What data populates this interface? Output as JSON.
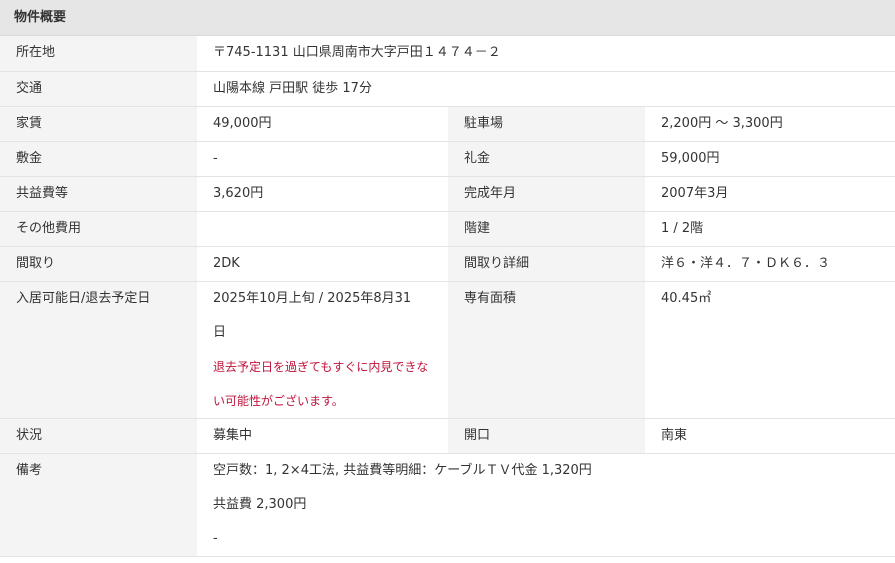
{
  "section_title": "物件概要",
  "rows": {
    "address": {
      "label": "所在地",
      "value": "〒745-1131 山口県周南市大字戸田１４７４－２"
    },
    "access": {
      "label": "交通",
      "value": "山陽本線 戸田駅 徒歩 17分"
    },
    "rent": {
      "label": "家賃",
      "value": "49,000円"
    },
    "parking": {
      "label": "駐車場",
      "value": "2,200円 ～ 3,300円"
    },
    "deposit": {
      "label": "敷金",
      "value": "-"
    },
    "key_money": {
      "label": "礼金",
      "value": "59,000円"
    },
    "common_fee": {
      "label": "共益費等",
      "value": "3,620円"
    },
    "built": {
      "label": "完成年月",
      "value": "2007年3月"
    },
    "other_costs": {
      "label": "その他費用",
      "value": ""
    },
    "floor": {
      "label": "階建",
      "value": "1 / 2階"
    },
    "layout": {
      "label": "間取り",
      "value": "2DK"
    },
    "layout_detail": {
      "label": "間取り詳細",
      "value": "洋６・洋４．７・ＤＫ６．３"
    },
    "move_in": {
      "label": "入居可能日/退去予定日",
      "value_line1": "2025年10月上旬 / 2025年8月31",
      "value_line2": "日",
      "note_line1": "退去予定日を過ぎてもすぐに内見できな",
      "note_line2": "い可能性がございます。"
    },
    "area": {
      "label": "専有面積",
      "value": "40.45㎡"
    },
    "status": {
      "label": "状況",
      "value": "募集中"
    },
    "facing": {
      "label": "開口",
      "value": "南東"
    },
    "remarks": {
      "label": "備考",
      "line1": "空戸数：1, 2×4工法, 共益費等明細：ケーブルＴＶ代金 1,320円",
      "line2": "共益費 2,300円",
      "line3": "-"
    }
  },
  "colors": {
    "header_bg": "#e6e6e6",
    "label_bg": "#f4f4f4",
    "border": "#e3e3e3",
    "warning_text": "#c0143c"
  }
}
